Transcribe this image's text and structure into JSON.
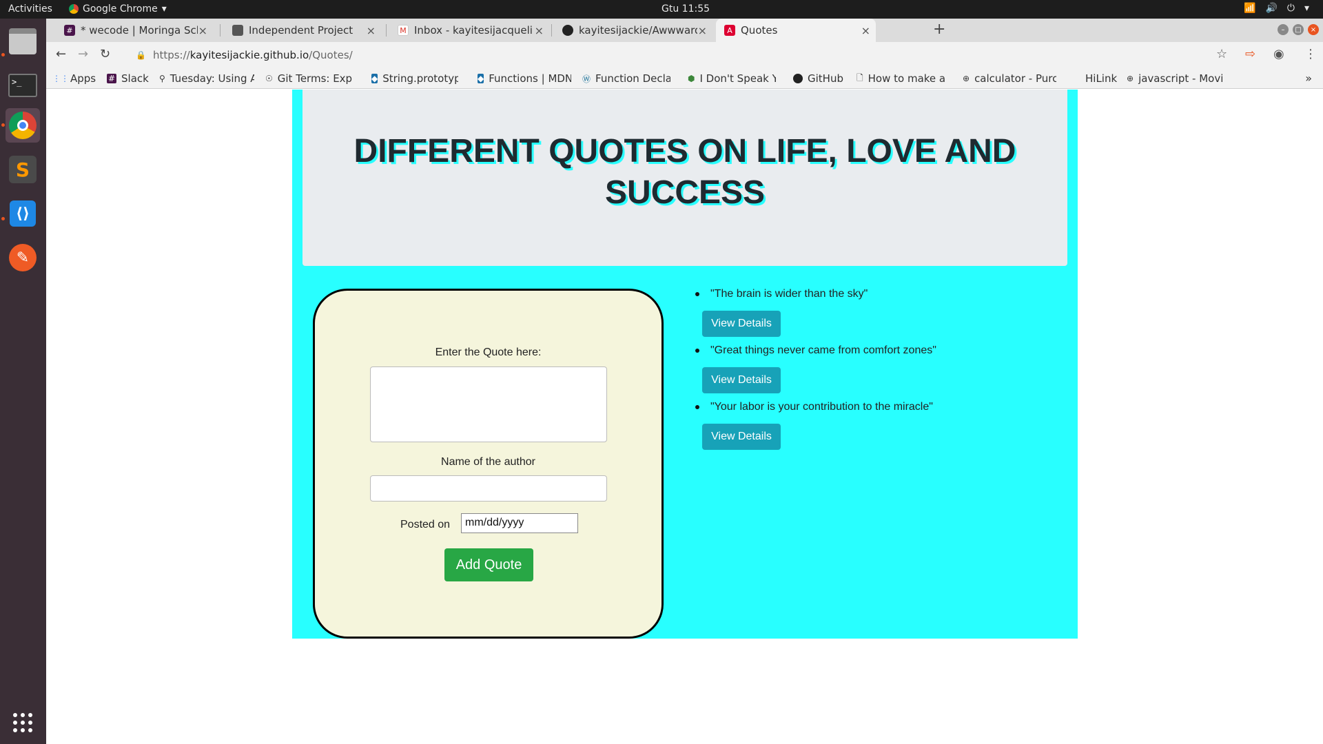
{
  "system": {
    "activities": "Activities",
    "app_name": "Google Chrome",
    "clock": "Gtu 11:55"
  },
  "tabs": [
    {
      "title": "* wecode | Moringa Schoo",
      "icon": "slack-icon"
    },
    {
      "title": "Independent Project",
      "icon": "page-icon"
    },
    {
      "title": "Inbox - kayitesijacqueline",
      "icon": "gmail-icon"
    },
    {
      "title": "kayitesijackie/Awwward-",
      "icon": "github-icon"
    },
    {
      "title": "Quotes",
      "icon": "angular-icon",
      "active": true
    }
  ],
  "address": {
    "scheme": "https://",
    "host": "kayitesijackie.github.io",
    "path": "/Quotes/"
  },
  "bookmarks": [
    {
      "label": "Apps",
      "icon": "apps-grid-icon"
    },
    {
      "label": "Slack",
      "icon": "slack-icon"
    },
    {
      "label": "Tuesday: Using A",
      "icon": "pin-icon"
    },
    {
      "label": "Git Terms: Explai",
      "icon": "git-icon"
    },
    {
      "label": "String.prototype",
      "icon": "mdn-icon"
    },
    {
      "label": "Functions | MDN",
      "icon": "mdn-icon"
    },
    {
      "label": "Function Declara",
      "icon": "wordpress-icon"
    },
    {
      "label": "I Don't Speak Yo",
      "icon": "node-icon"
    },
    {
      "label": "GitHub",
      "icon": "github-icon"
    },
    {
      "label": "How to make a s",
      "icon": "doc-icon"
    },
    {
      "label": "calculator - Purc",
      "icon": "globe-icon"
    },
    {
      "label": "HiLink",
      "icon": ""
    },
    {
      "label": "javascript - Movi",
      "icon": "globe-icon"
    }
  ],
  "page": {
    "headline": "DIFFERENT QUOTES ON LIFE, LOVE AND SUCCESS",
    "form": {
      "quote_label": "Enter the Quote here:",
      "author_label": "Name of the author",
      "posted_label": "Posted on",
      "date_placeholder": "mm/dd/yyyy",
      "submit_label": "Add Quote"
    },
    "quotes": [
      {
        "text": "\"The brain is wider than the sky\"",
        "button": "View Details"
      },
      {
        "text": "\"Great things never came from comfort zones\"",
        "button": "View Details"
      },
      {
        "text": "\"Your labor is your contribution to the miracle\"",
        "button": "View Details"
      }
    ]
  },
  "colors": {
    "page_background": "#28ffff",
    "jumbotron": "#e9ecef",
    "form_card": "#f5f5dc",
    "add_button": "#28a745",
    "details_button": "#17a2b8"
  }
}
